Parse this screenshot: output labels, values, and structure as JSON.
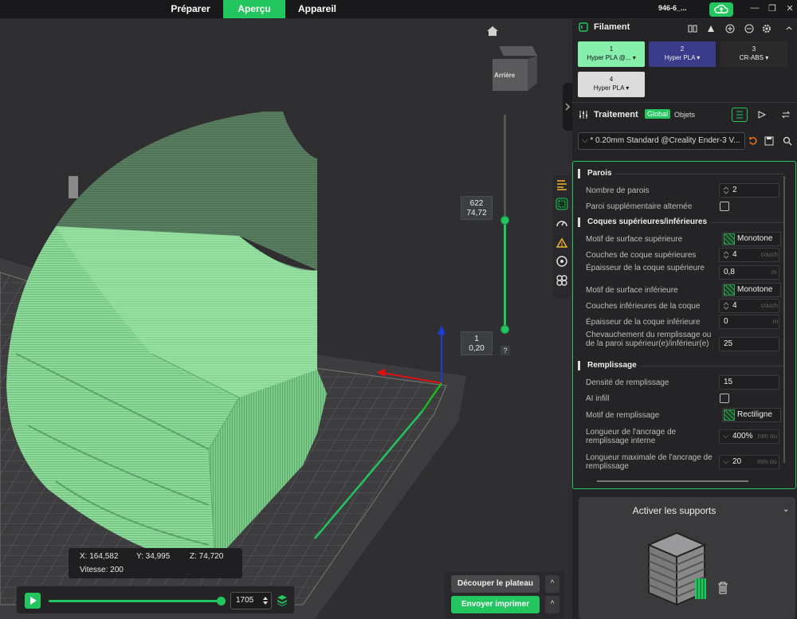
{
  "topbar": {
    "tabs": [
      "Préparer",
      "Aperçu",
      "Appareil"
    ],
    "active_tab": "Aperçu",
    "doc_title": "946-6_...",
    "accent": "#22c55e"
  },
  "viewport": {
    "view_cube_label": "Arrière",
    "layer_slider": {
      "top_layer": "622",
      "top_height": "74,72",
      "bottom_layer": "1",
      "bottom_height": "0,20",
      "help": "?"
    },
    "coords": {
      "x": "X: 164,582",
      "y": "Y: 34,995",
      "z": "Z: 74,720",
      "speed": "Vitesse: 200"
    },
    "playback": {
      "frame": "1705",
      "progress": 1.0
    },
    "buttons": {
      "slice": "Découper le plateau",
      "print": "Envoyer imprimer",
      "caret": "^"
    },
    "model_color": "#8fd99a"
  },
  "filament": {
    "title": "Filament",
    "items": [
      {
        "index": "1",
        "name": "Hyper PLA @...",
        "color": "#86efac",
        "text_color": "#111"
      },
      {
        "index": "2",
        "name": "Hyper PLA",
        "color": "#3b3b8c",
        "text_color": "#eee"
      },
      {
        "index": "3",
        "name": "CR-ABS",
        "color": "#2a2a2a",
        "text_color": "#eee"
      },
      {
        "index": "4",
        "name": "Hyper PLA",
        "color": "#dcdcdc",
        "text_color": "#111"
      }
    ]
  },
  "process": {
    "title": "Traitement",
    "global": "Global",
    "objects": "Objets",
    "preset": "* 0.20mm Standard @Creality Ender-3 V...",
    "groups": {
      "walls": "Parois",
      "shells": "Coques supérieures/inférieures",
      "infill": "Remplissage"
    },
    "rows": {
      "wall_count_label": "Nombre de parois",
      "wall_count": "2",
      "alt_wall_label": "Paroi supplémentaire alternée",
      "top_pattern_label": "Motif de surface supérieure",
      "top_pattern": "Monotone",
      "top_layers_label": "Couches de coque supérieures",
      "top_layers": "4",
      "top_layers_unit": "couch",
      "top_thick_label": "Épaisseur de la coque supérieure",
      "top_thick": "0,8",
      "top_thick_unit": "m",
      "bottom_pattern_label": "Motif de surface inférieure",
      "bottom_pattern": "Monotone",
      "bottom_layers_label": "Couches inférieures de la coque",
      "bottom_layers": "4",
      "bottom_layers_unit": "couch",
      "bottom_thick_label": "Épaisseur de la coque inférieure",
      "bottom_thick": "0",
      "bottom_thick_unit": "m",
      "overlap_label": "Chevauchement du remplissage ou de la paroi supérieur(e)/inférieur(e)",
      "overlap": "25",
      "density_label": "Densité de remplissage",
      "density": "15",
      "ai_infill_label": "AI infill",
      "infill_pattern_label": "Motif de remplissage",
      "infill_pattern": "Rectiligne",
      "anchor_label": "Longueur de l'ancrage de remplissage interne",
      "anchor": "400%",
      "anchor_unit": "mm ou",
      "anchor_max_label": "Longueur maximale de l'ancrage de remplissage",
      "anchor_max": "20",
      "anchor_max_unit": "mm ou"
    }
  },
  "support": {
    "title": "Activer les supports",
    "caret": "⌄"
  }
}
